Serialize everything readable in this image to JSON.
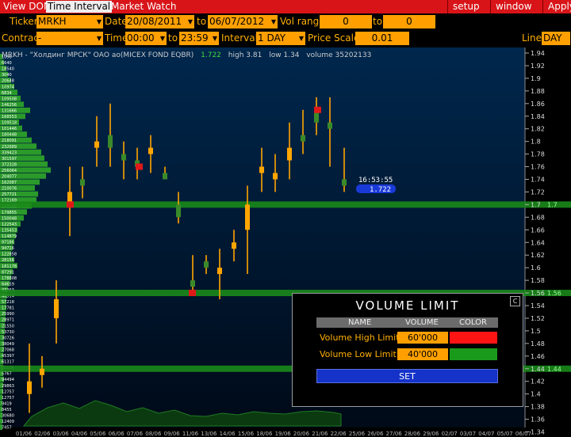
{
  "menubar": {
    "tabs": [
      "View DOM",
      "Time Interval",
      "Market Watch"
    ],
    "right": [
      "setup",
      "window",
      "Apply"
    ]
  },
  "toolbar1": {
    "ticker_label": "Ticker",
    "ticker_value": "MRKH",
    "date_label": "Date",
    "date_from": "20/08/2011",
    "date_to_label": "to",
    "date_to": "06/07/2012",
    "vol_range_label": "Vol range",
    "vol_from": "0",
    "vol_to_label": "to",
    "vol_to": "0"
  },
  "toolbar2": {
    "contract_label": "Contract",
    "contract_value": "-",
    "time_label": "Time",
    "time_from": "00:00",
    "time_to_label": "to",
    "time_to": "23:59",
    "interval_label": "Interval",
    "interval_value": "1 DAY",
    "price_scale_label": "Price Scale",
    "price_scale_value": "0.01",
    "line_label": "Line",
    "line_value": "DAY"
  },
  "chart_info": {
    "symbol": "MRKH - \"Холдинг МРСК\" ОАО ао(MICEX FOND EQBR)",
    "last": "1.722",
    "high": "high 3.81",
    "low": "low 1.34",
    "volume": "volume 35202133"
  },
  "price_axis": [
    "1.94",
    "1.92",
    "1.9",
    "1.88",
    "1.86",
    "1.84",
    "1.82",
    "1.8",
    "1.78",
    "1.76",
    "1.74",
    "1.72",
    "1.7",
    "1.68",
    "1.66",
    "1.64",
    "1.62",
    "1.6",
    "1.58",
    "1.56",
    "1.54",
    "1.52",
    "1.5",
    "1.48",
    "1.46",
    "1.44",
    "1.42",
    "1.4",
    "1.38",
    "1.36",
    "1.34"
  ],
  "time_axis": [
    "01/06",
    "02/06",
    "03/06",
    "04/06",
    "05/06",
    "06/06",
    "07/06",
    "08/06",
    "09/06",
    "11/06",
    "13/06",
    "14/06",
    "15/06",
    "18/06",
    "19/06",
    "20/06",
    "21/06",
    "22/06",
    "25/06",
    "26/06",
    "27/06",
    "28/06",
    "29/06",
    "02/07",
    "03/07",
    "04/07",
    "05/07",
    "06/07"
  ],
  "volume_profile_labels": [
    "1096",
    "6640",
    "18540",
    "3040",
    "20648",
    "10974",
    "6834",
    "109508",
    "146256",
    "131666",
    "168553",
    "109518",
    "101446",
    "180448",
    "218091",
    "232689",
    "339423",
    "301597",
    "372328",
    "256064",
    "204077",
    "162087",
    "210076",
    "257721",
    "172169",
    "143585",
    "179855",
    "150048",
    "122543",
    "135453",
    "114879",
    "97186",
    "94716",
    "122858",
    "28156",
    "181178",
    "87291",
    "178808",
    "64659",
    "43263",
    "46914",
    "57218",
    "17781",
    "25990",
    "28971",
    "21550",
    "53730",
    "30726",
    "38049",
    "27068",
    "45397",
    "61317",
    "35126",
    "5767",
    "94494",
    "29863",
    "12757",
    "12757",
    "9419",
    "8455",
    "30680",
    "12409",
    "7457"
  ],
  "current_price_label": {
    "time": "16:53:55",
    "price": "1.722"
  },
  "level_lines": [
    {
      "price": 1.7,
      "label": "1.7"
    },
    {
      "price": 1.56,
      "label": "1.56"
    },
    {
      "price": 1.44,
      "label": "1.44"
    }
  ],
  "colors": {
    "up": "#ffa500",
    "down": "#3a8a2a",
    "highlight": "#e01818",
    "panel_bg": "#001a3a",
    "level": "#1a8a1a"
  },
  "volume_limit": {
    "title": "VOLUME LIMIT",
    "close_icon": "C",
    "headers": [
      "NAME",
      "VOLUME",
      "COLOR"
    ],
    "rows": [
      {
        "name": "Volume High Limit",
        "volume": "60'000",
        "color": "#ff1414"
      },
      {
        "name": "Volume Low Limit",
        "volume": "40'000",
        "color": "#1a9a1a"
      }
    ],
    "set_label": "SET"
  }
}
